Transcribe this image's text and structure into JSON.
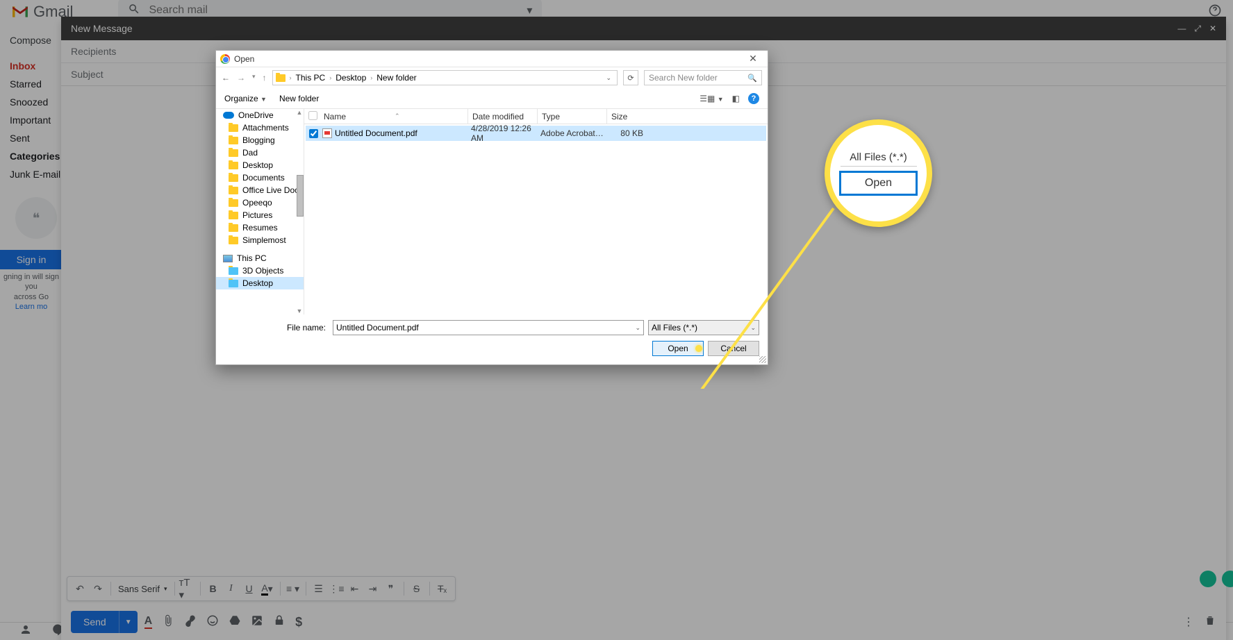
{
  "gmail": {
    "logo_text": "Gmail",
    "search_placeholder": "Search mail",
    "compose": "Compose",
    "sidebar": [
      {
        "label": "Inbox",
        "active": true
      },
      {
        "label": "Starred"
      },
      {
        "label": "Snoozed"
      },
      {
        "label": "Important"
      },
      {
        "label": "Sent"
      },
      {
        "label": "Categories",
        "bold": true
      },
      {
        "label": "Junk E-mail"
      }
    ],
    "signin_button": "Sign in",
    "signin_note_1": "gning in will sign you",
    "signin_note_2": "across Go",
    "signin_learn": "Learn mo"
  },
  "compose": {
    "title": "New Message",
    "recipients": "Recipients",
    "subject": "Subject",
    "font": "Sans Serif",
    "send": "Send"
  },
  "dialog": {
    "title": "Open",
    "breadcrumb": [
      "This PC",
      "Desktop",
      "New folder"
    ],
    "search_placeholder": "Search New folder",
    "organize": "Organize",
    "new_folder": "New folder",
    "tree_root": "OneDrive",
    "tree_folders": [
      "Attachments",
      "Blogging",
      "Dad",
      "Desktop",
      "Documents",
      "Office Live Docu",
      "Opeeqo",
      "Pictures",
      "Resumes",
      "Simplemost"
    ],
    "tree_root2": "This PC",
    "tree_pc": [
      "3D Objects",
      "Desktop"
    ],
    "columns": {
      "name": "Name",
      "date": "Date modified",
      "type": "Type",
      "size": "Size"
    },
    "file": {
      "name": "Untitled Document.pdf",
      "date": "4/28/2019 12:26 AM",
      "type": "Adobe Acrobat D...",
      "size": "80 KB"
    },
    "filename_label": "File name:",
    "filename_value": "Untitled Document.pdf",
    "filter": "All Files (*.*)",
    "open_btn": "Open",
    "cancel_btn": "Cancel"
  },
  "callout": {
    "filter": "All Files (*.*)",
    "button": "Open"
  }
}
